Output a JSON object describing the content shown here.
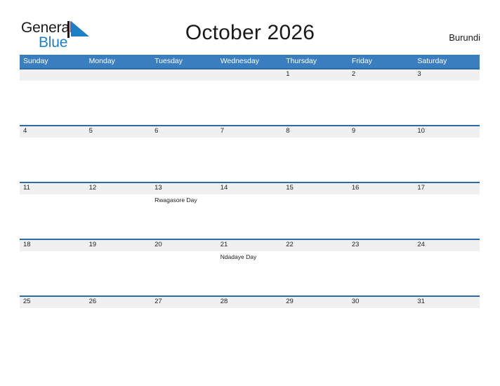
{
  "brand": {
    "word_one": "General",
    "word_two": "Blue",
    "triangle_color": "#1f7fc4",
    "text_color": "#1a1a1a"
  },
  "header": {
    "title": "October 2026",
    "country": "Burundi"
  },
  "theme": {
    "header_blue": "#3a7ec0",
    "band_gray": "#f0f0f0",
    "band_border": "#2b6ca8"
  },
  "calendar": {
    "weekdays": [
      "Sunday",
      "Monday",
      "Tuesday",
      "Wednesday",
      "Thursday",
      "Friday",
      "Saturday"
    ],
    "weeks": [
      [
        {
          "day": "",
          "events": []
        },
        {
          "day": "",
          "events": []
        },
        {
          "day": "",
          "events": []
        },
        {
          "day": "",
          "events": []
        },
        {
          "day": "1",
          "events": []
        },
        {
          "day": "2",
          "events": []
        },
        {
          "day": "3",
          "events": []
        }
      ],
      [
        {
          "day": "4",
          "events": []
        },
        {
          "day": "5",
          "events": []
        },
        {
          "day": "6",
          "events": []
        },
        {
          "day": "7",
          "events": []
        },
        {
          "day": "8",
          "events": []
        },
        {
          "day": "9",
          "events": []
        },
        {
          "day": "10",
          "events": []
        }
      ],
      [
        {
          "day": "11",
          "events": []
        },
        {
          "day": "12",
          "events": []
        },
        {
          "day": "13",
          "events": [
            "Rwagasore Day"
          ]
        },
        {
          "day": "14",
          "events": []
        },
        {
          "day": "15",
          "events": []
        },
        {
          "day": "16",
          "events": []
        },
        {
          "day": "17",
          "events": []
        }
      ],
      [
        {
          "day": "18",
          "events": []
        },
        {
          "day": "19",
          "events": []
        },
        {
          "day": "20",
          "events": []
        },
        {
          "day": "21",
          "events": [
            "Ndadaye Day"
          ]
        },
        {
          "day": "22",
          "events": []
        },
        {
          "day": "23",
          "events": []
        },
        {
          "day": "24",
          "events": []
        }
      ],
      [
        {
          "day": "25",
          "events": []
        },
        {
          "day": "26",
          "events": []
        },
        {
          "day": "27",
          "events": []
        },
        {
          "day": "28",
          "events": []
        },
        {
          "day": "29",
          "events": []
        },
        {
          "day": "30",
          "events": []
        },
        {
          "day": "31",
          "events": []
        }
      ]
    ]
  }
}
